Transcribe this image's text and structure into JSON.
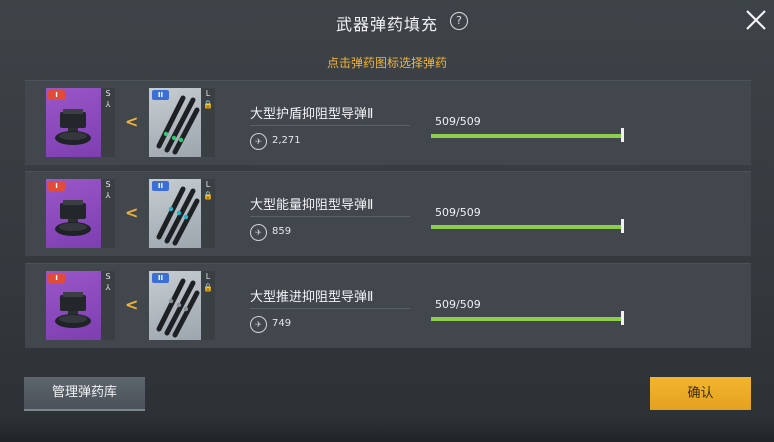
{
  "header": {
    "title": "武器弹药填充",
    "help_symbol": "?"
  },
  "hint": "点击弹药图标选择弹药",
  "rows": [
    {
      "weapon_tier": "I",
      "weapon_sizes": [
        "S",
        "⅄"
      ],
      "ammo_tier": "II",
      "ammo_size": "L",
      "ammo_color": "#2ecc71",
      "name": "大型护盾抑阻型导弹Ⅱ",
      "stock": "2,271",
      "ammo_text": "509/509",
      "fill": 1.0
    },
    {
      "weapon_tier": "I",
      "weapon_sizes": [
        "S",
        "⅄"
      ],
      "ammo_tier": "II",
      "ammo_size": "L",
      "ammo_color": "#21b5c9",
      "name": "大型能量抑阻型导弹Ⅱ",
      "stock": "859",
      "ammo_text": "509/509",
      "fill": 1.0
    },
    {
      "weapon_tier": "I",
      "weapon_sizes": [
        "S",
        "⅄"
      ],
      "ammo_tier": "II",
      "ammo_size": "L",
      "ammo_color": "#8a939b",
      "name": "大型推进抑阻型导弹Ⅱ",
      "stock": "749",
      "ammo_text": "509/509",
      "fill": 1.0
    }
  ],
  "footer": {
    "manage_label": "管理弹药库",
    "confirm_label": "确认"
  },
  "colors": {
    "accent": "#f0b43a",
    "bar": "#8ccf4d",
    "weapon_slot": "#8e4cc1"
  }
}
